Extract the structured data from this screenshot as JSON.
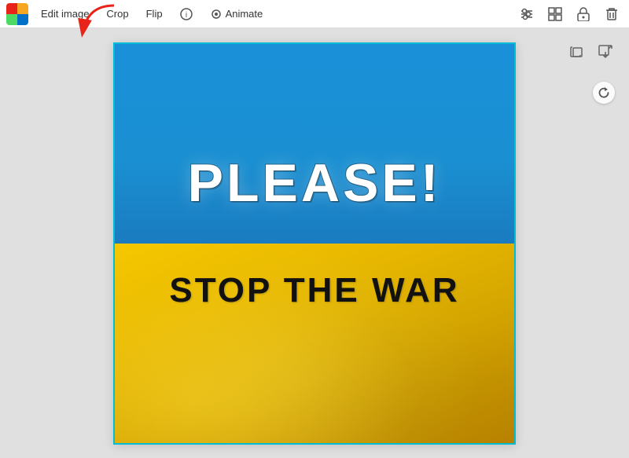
{
  "toolbar": {
    "edit_image_label": "Edit image",
    "crop_label": "Crop",
    "flip_label": "Flip",
    "info_label": "ℹ",
    "animate_label": "Animate",
    "icons": {
      "filter": "⊞",
      "grid": "⊡",
      "lock": "🔒",
      "trash": "🗑",
      "copy": "⧉",
      "export": "↑",
      "refresh": "↺"
    }
  },
  "canvas": {
    "image_text_1": "PLEASE!",
    "image_text_2": "STOP THE WAR"
  },
  "annotation": {
    "arrow_color": "#e8231a"
  }
}
